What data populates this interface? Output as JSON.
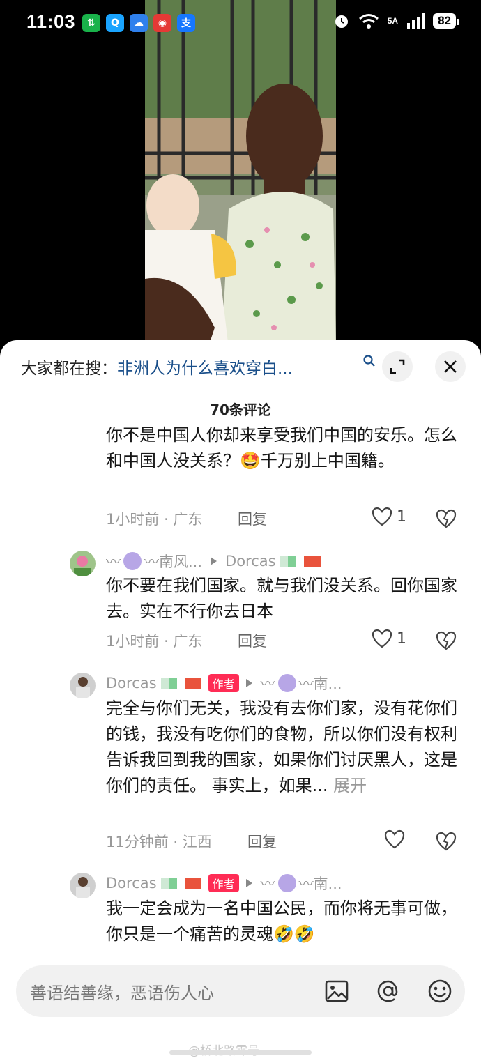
{
  "status_bar": {
    "time": "11:03",
    "network": "5A",
    "battery": "82",
    "app_icons": [
      {
        "name": "transfer-app-icon",
        "glyph": "⇅",
        "color": "#19b24a"
      },
      {
        "name": "chat-app-icon",
        "glyph": "Q",
        "color": "#1aa4ff"
      },
      {
        "name": "cloud-app-icon",
        "glyph": "☁",
        "color": "#2f80ed"
      },
      {
        "name": "mobile-app-icon",
        "glyph": "◉",
        "color": "#e53935"
      },
      {
        "name": "alipay-app-icon",
        "glyph": "支",
        "color": "#1677ff"
      }
    ]
  },
  "sheet": {
    "search_prefix": "大家都在搜：",
    "search_query": "非洲人为什么喜欢穿白...",
    "comment_count_title": "70条评论"
  },
  "comments": [
    {
      "text": "你不是中国人你却来享受我们中国的安乐。怎么和中国人没关系？🤩千万别上中国籍。",
      "time": "1小时前",
      "location": "广东",
      "reply_label": "回复",
      "likes": "1"
    },
    {
      "user": "南风...",
      "reply_to": "Dorcas",
      "text": "你不要在我们国家。就与我们没关系。回你国家去。实在不行你去日本",
      "time": "1小时前",
      "location": "广东",
      "reply_label": "回复",
      "likes": "1"
    },
    {
      "user": "Dorcas",
      "badge": "作者",
      "reply_to": "南...",
      "text": "完全与你们无关，我没有去你们家，没有花你们的钱，我没有吃你们的食物，所以你们没有权利告诉我回到我的国家，如果你们讨厌黑人，这是你们的责任。 事实上，如果...",
      "expand_label": "展开",
      "time": "11分钟前",
      "location": "江西",
      "reply_label": "回复",
      "likes": ""
    },
    {
      "user": "Dorcas",
      "badge": "作者",
      "reply_to": "南...",
      "text": "我一定会成为一名中国公民，而你将无事可做，你只是一个痛苦的灵魂🤣🤣"
    }
  ],
  "input": {
    "placeholder": "善语结善缘，恶语伤人心"
  },
  "watermark": "@桥北路零号",
  "separator": "·",
  "flag_colors": [
    "#cfe9d5",
    "#7fcf95",
    "#ffffff",
    "#e9533c",
    "#e9533c"
  ]
}
